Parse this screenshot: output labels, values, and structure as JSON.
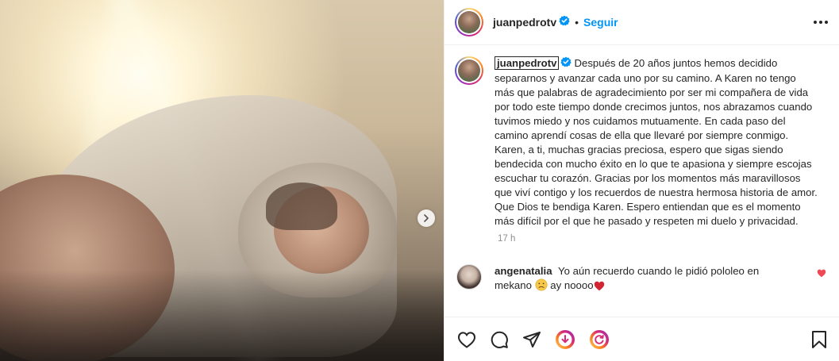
{
  "post": {
    "author": {
      "username": "juanpedrotv",
      "verified": true,
      "follow_label": "Seguir",
      "separator": "•"
    },
    "caption": {
      "username": "juanpedrotv",
      "text": "Después de 20 años juntos hemos decidido separarnos y avanzar cada uno por su camino. A Karen no tengo más que palabras de agradecimiento por ser mi compañera de vida por todo este tiempo donde crecimos juntos, nos abrazamos cuando tuvimos miedo y nos cuidamos mutuamente. En cada paso del camino aprendí cosas de ella que llevaré por siempre conmigo. Karen, a ti, muchas gracias preciosa, espero que sigas siendo bendecida con mucho éxito en lo que te apasiona y siempre escojas escuchar tu corazón. Gracias por los momentos más maravillosos que viví contigo y los recuerdos de nuestra hermosa historia de amor. Que Dios te bendiga Karen. Espero entiendan que es el momento más difícil por el que he pasado y respeten mi duelo y privacidad.",
      "time": "17 h"
    },
    "comments": [
      {
        "username": "angenatalia",
        "text_before": "Yo aún recuerdo cuando le pidió pololeo en mekano",
        "text_after": "ay noooo",
        "emoji_1": "sad-face-emoji",
        "emoji_2": "red-heart-emoji",
        "liked": true
      }
    ],
    "colors": {
      "accent": "#0095f6",
      "like": "#ed4956",
      "text": "#262626",
      "muted": "#8e8e8e"
    },
    "icons": {
      "like": "heart-icon",
      "comment": "comment-icon",
      "share": "paper-plane-icon",
      "save": "bookmark-icon",
      "next": "chevron-right-icon"
    }
  }
}
